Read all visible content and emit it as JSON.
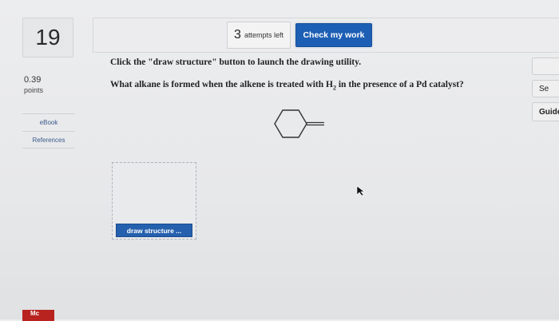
{
  "question": {
    "number": "19",
    "score": "0.39",
    "points_label": "points",
    "instruction": "Click the \"draw structure\" button to launch the drawing utility.",
    "text_before": "What alkane is formed when the alkene is treated with H",
    "subscript": "2",
    "text_after": " in the presence of a Pd catalyst?"
  },
  "sidebar": {
    "ebook_label": "eBook",
    "references_label": "References"
  },
  "toolbar": {
    "attempts_count": "3",
    "attempts_label": "attempts left",
    "check_label": "Check my work"
  },
  "workspace": {
    "draw_button_label": "draw structure ..."
  },
  "right_panel": {
    "btn2_label": "Se",
    "guide_label": "Guide"
  },
  "footer": {
    "badge_text": "Mc"
  },
  "colors": {
    "accent": "#1d5fb4",
    "background": "#e8e9eb"
  }
}
